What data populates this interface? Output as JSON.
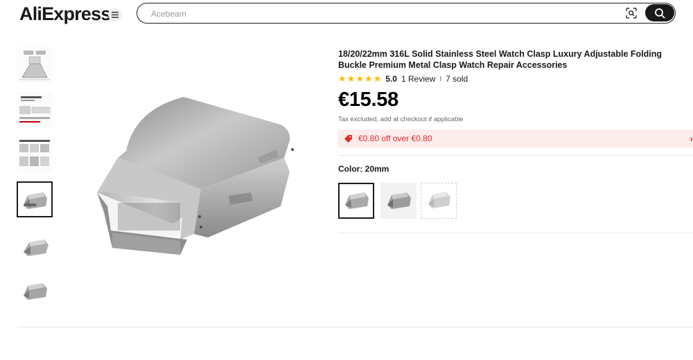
{
  "header": {
    "logo_text": "AliExpress",
    "search_placeholder": "Acebeam",
    "icons": [
      "menu-icon",
      "camera-search-icon",
      "search-icon"
    ]
  },
  "gallery": {
    "thumbnails": [
      {
        "name": "thumbnail-1",
        "depicts": "clasp-dimensions-diagram"
      },
      {
        "name": "thumbnail-2",
        "depicts": "clasp-size-chart"
      },
      {
        "name": "thumbnail-3",
        "depicts": "installation-guide"
      },
      {
        "name": "thumbnail-4",
        "depicts": "clasp-front",
        "active": true
      },
      {
        "name": "thumbnail-5",
        "depicts": "clasp-angled"
      },
      {
        "name": "thumbnail-6",
        "depicts": "clasp-side"
      }
    ]
  },
  "product": {
    "title": "18/20/22mm 316L Solid Stainless Steel Watch Clasp Luxury Adjustable Folding Buckle Premium Metal Clasp Watch Repair Accessories",
    "rating": {
      "stars": 5,
      "score": "5.0",
      "reviews": "1 Review",
      "separator": "I",
      "sold": "7 sold"
    },
    "price": "€15.58",
    "tax_note": "Tax excluded, add at checkout if applicable",
    "promo": {
      "text": "€0.80 off over €0.80",
      "chevron": "›"
    },
    "color": {
      "label": "Color: 20mm",
      "options": [
        {
          "name": "20mm",
          "selected": true
        },
        {
          "name": "option-2",
          "selected": false
        },
        {
          "name": "option-3",
          "selected": false,
          "unavailable": true
        }
      ]
    }
  },
  "colors": {
    "accent_red": "#e22a2a",
    "promo_bg": "#fdecec",
    "star": "#fdb900",
    "dark": "#191919"
  }
}
